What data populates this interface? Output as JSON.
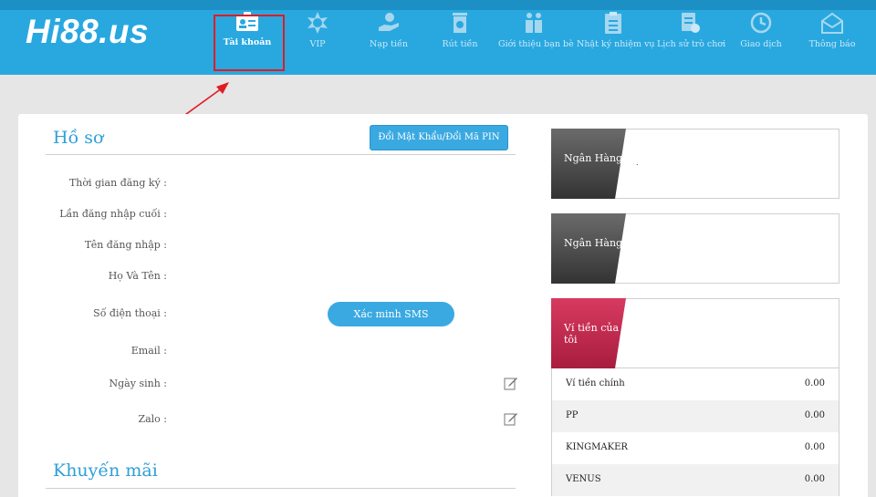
{
  "header": {
    "logo": "Hi88.us",
    "nav": [
      {
        "label": "Tài khoản",
        "icon": "id-card-icon",
        "active": true
      },
      {
        "label": "VIP",
        "icon": "vip-badge-icon"
      },
      {
        "label": "Nạp tiền",
        "icon": "deposit-hand-icon"
      },
      {
        "label": "Rút tiền",
        "icon": "withdraw-safe-icon"
      },
      {
        "label": "Giới thiệu bạn bè",
        "icon": "referral-gift-icon"
      },
      {
        "label": "Nhật ký nhiệm vụ",
        "icon": "task-clipboard-icon"
      },
      {
        "label": "Lịch sử trò chơi",
        "icon": "game-history-icon"
      },
      {
        "label": "Giao dịch",
        "icon": "transaction-clock-icon"
      },
      {
        "label": "Thông báo",
        "icon": "notification-mail-icon"
      }
    ]
  },
  "profile": {
    "title": "Hồ sơ",
    "change_pin_button": "Đổi Mật Khẩu/Đổi Mã PIN",
    "fields": {
      "register_time": "Thời gian đăng ký :",
      "last_login": "Lần đăng nhập cuối :",
      "username": "Tên đăng nhập :",
      "fullname": "Họ Và Tên :",
      "phone": "Số điện thoại :",
      "email": "Email :",
      "birthday": "Ngày sinh :",
      "zalo": "Zalo :"
    },
    "sms_button": "Xác minh SMS"
  },
  "promotions": {
    "title": "Khuyến mãi"
  },
  "bank_cards": [
    {
      "label": "Ngân Hàng",
      "value": "."
    },
    {
      "label": "Ngân Hàng",
      "value": ""
    }
  ],
  "wallet": {
    "label": "Ví tiền của tôi",
    "rows": [
      {
        "name": "Ví tiền chính",
        "value": "0.00"
      },
      {
        "name": "PP",
        "value": "0.00"
      },
      {
        "name": "KINGMAKER",
        "value": "0.00"
      },
      {
        "name": "VENUS",
        "value": "0.00"
      }
    ]
  },
  "colors": {
    "header_blue": "#29a8e0",
    "accent_blue": "#3aa9e1",
    "highlight_red": "#e11b22",
    "bank_tab": "#4a4a4a",
    "wallet_tab": "#c8294e"
  }
}
